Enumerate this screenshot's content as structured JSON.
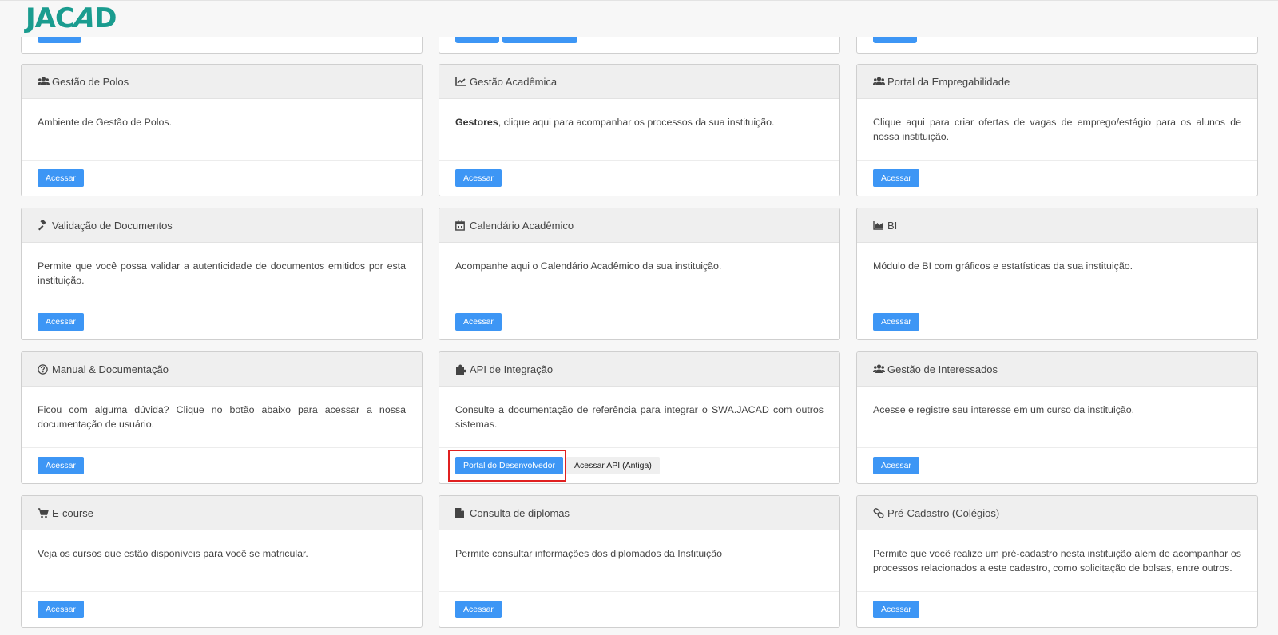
{
  "header": {
    "logo_text": "JACAD",
    "logo_part1": "JAC",
    "logo_slash": "A",
    "logo_part2": "D"
  },
  "cards": [
    {
      "title": "Gestão de Polos",
      "icon": "users-icon",
      "body": "Ambiente de Gestão de Polos.",
      "buttons": [
        "Acessar"
      ]
    },
    {
      "title": "Gestão Acadêmica",
      "icon": "line-chart-icon",
      "body_bold": "Gestores",
      "body": ", clique aqui para acompanhar os processos da sua instituição.",
      "buttons": [
        "Acessar"
      ]
    },
    {
      "title": "Portal da Empregabilidade",
      "icon": "users-icon",
      "body": "Clique aqui para criar ofertas de vagas de emprego/estágio para os alunos de nossa instituição.",
      "buttons": [
        "Acessar"
      ]
    },
    {
      "title": "Validação de Documentos",
      "icon": "gavel-icon",
      "body": "Permite que você possa validar a autenticidade de documentos emitidos por esta instituição.",
      "buttons": [
        "Acessar"
      ]
    },
    {
      "title": "Calendário Acadêmico",
      "icon": "calendar-icon",
      "body": "Acompanhe aqui o Calendário Acadêmico da sua instituição.",
      "buttons": [
        "Acessar"
      ]
    },
    {
      "title": "BI",
      "icon": "area-chart-icon",
      "body": "Módulo de BI com gráficos e estatísticas da sua instituição.",
      "buttons": [
        "Acessar"
      ]
    },
    {
      "title": "Manual & Documentação",
      "icon": "question-circle-icon",
      "body": "Ficou com alguma dúvida? Clique no botão abaixo para acessar a nossa documentação de usuário.",
      "buttons": [
        "Acessar"
      ]
    },
    {
      "title": "API de Integração",
      "icon": "puzzle-icon",
      "body": "Consulte a documentação de referência para integrar o SWA.JACAD com outros sistemas.",
      "buttons": [
        "Portal do Desenvolvedor",
        "Acessar API (Antiga)"
      ]
    },
    {
      "title": "Gestão de Interessados",
      "icon": "users-icon",
      "body": "Acesse e registre seu interesse em um curso da instituição.",
      "buttons": [
        "Acessar"
      ]
    },
    {
      "title": "E-course",
      "icon": "cart-icon",
      "body": "Veja os cursos que estão disponíveis para você se matricular.",
      "buttons": [
        "Acessar"
      ]
    },
    {
      "title": "Consulta de diplomas",
      "icon": "file-icon",
      "body": "Permite consultar informações dos diplomados da Instituição",
      "buttons": [
        "Acessar"
      ]
    },
    {
      "title": "Pré-Cadastro (Colégios)",
      "icon": "link-icon",
      "body": "Permite que você realize um pré-cadastro nesta instituição além de acompanhar os processos relacionados a este cadastro, como solicitação de bolsas, entre outros.",
      "buttons": [
        "Acessar"
      ]
    }
  ],
  "colors": {
    "primary_button": "#3d96f5",
    "logo": "#1a9c8f",
    "highlight": "#e02020"
  }
}
